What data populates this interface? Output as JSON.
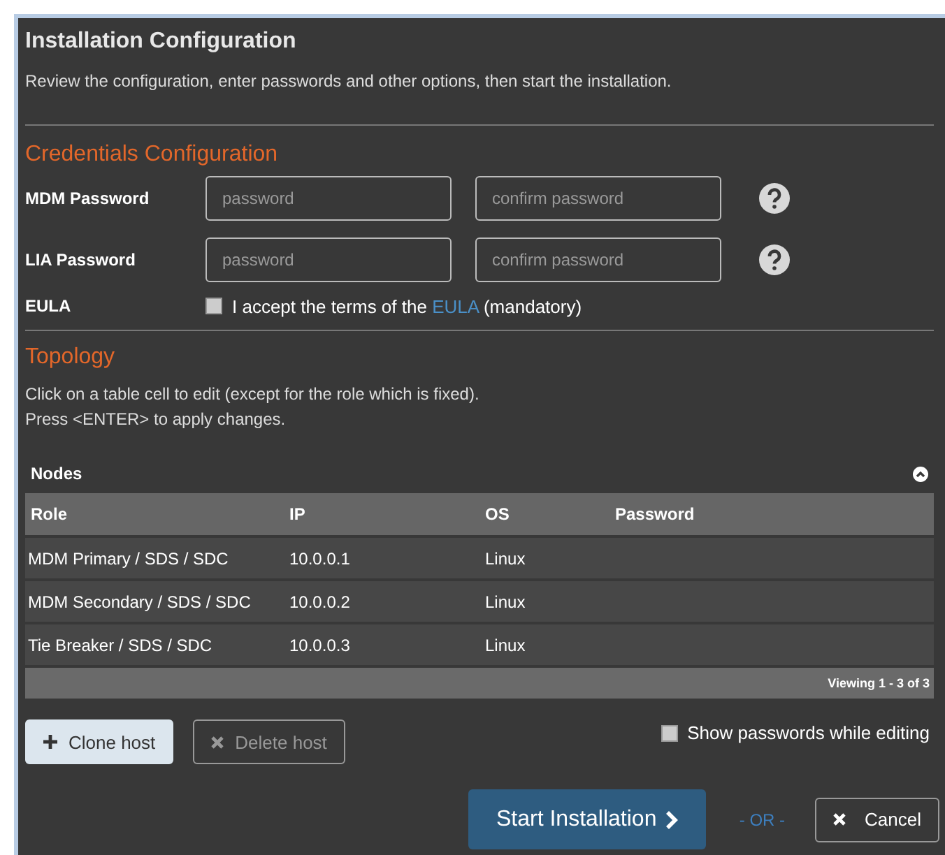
{
  "window": {
    "title": "Installation Configuration",
    "description": "Review the configuration, enter passwords and other options, then start the installation."
  },
  "credentials": {
    "heading": "Credentials Configuration",
    "rows": [
      {
        "label": "MDM Password",
        "placeholder": "password",
        "confirm_placeholder": "confirm password"
      },
      {
        "label": "LIA Password",
        "placeholder": "password",
        "confirm_placeholder": "confirm password"
      }
    ],
    "eula": {
      "label": "EULA",
      "checked": false,
      "text_before": "I accept the terms of the",
      "link": "EULA",
      "text_after": "(mandatory)"
    }
  },
  "topology": {
    "heading": "Topology",
    "instructions": [
      "Click on a table cell to edit (except for the role which is fixed).",
      "Press <ENTER> to apply changes."
    ],
    "table": {
      "caption": "Nodes",
      "expanded": true,
      "columns": [
        "Role",
        "IP",
        "OS",
        "Password"
      ],
      "rows": [
        [
          "MDM Primary / SDS / SDC",
          "10.0.0.1",
          "Linux",
          ""
        ],
        [
          "MDM Secondary / SDS / SDC",
          "10.0.0.2",
          "Linux",
          ""
        ],
        [
          "Tie Breaker / SDS / SDC",
          "10.0.0.3",
          "Linux",
          ""
        ]
      ],
      "footer": "Viewing 1 - 3 of 3"
    }
  },
  "actions": {
    "clone": {
      "label": "Clone host",
      "disabled": false
    },
    "delete": {
      "label": "Delete host",
      "disabled": true
    },
    "show_passwords": {
      "label": "Show passwords while editing",
      "checked": false
    }
  },
  "footer": {
    "start": "Start Installation",
    "or": "- OR -",
    "cancel": "Cancel"
  }
}
